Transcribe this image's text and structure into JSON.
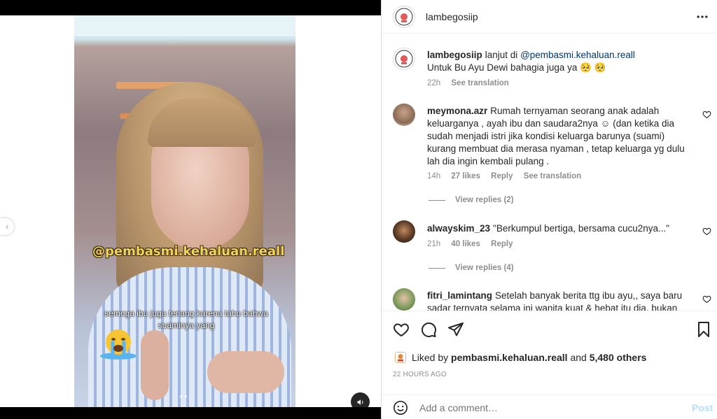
{
  "post": {
    "author": "lambegosiip",
    "caption": {
      "username": "lambegosiip",
      "text_before": "lanjut di ",
      "mention": "@pembasmi.kehaluan.reall",
      "line2": "Untuk Bu Ayu Dewi bahagia juga ya 🥺 🥺",
      "time": "22h",
      "see_translation": "See translation"
    }
  },
  "media": {
    "watermark": "@pembasmi.kehaluan.reall",
    "subtitle": "semoga ibu juga tenang karena tahu bahwa suaminya yang"
  },
  "comments": [
    {
      "username": "meymona.azr",
      "text": "Rumah ternyaman seorang anak adalah keluarganya , ayah ibu dan saudara2nya ☺ (dan ketika dia sudah menjadi istri jika kondisi keluarga barunya (suami) kurang membuat dia merasa nyaman , tetap keluarga yg dulu lah dia ingin kembali pulang .",
      "time": "14h",
      "likes": "27 likes",
      "reply": "Reply",
      "see_translation": "See translation",
      "view_replies": "View replies (2)"
    },
    {
      "username": "alwayskim_23",
      "text": "\"Berkumpul bertiga, bersama cucu2nya...\"",
      "time": "21h",
      "likes": "40 likes",
      "reply": "Reply",
      "view_replies": "View replies (4)"
    },
    {
      "username": "fitri_lamintang",
      "text": "Setelah banyak berita ttg ibu ayu,, saya baru sadar ternyata selama ini wanita kuat & hebat itu dia, bukan"
    }
  ],
  "likes_bar": {
    "prefix": "Liked by ",
    "user": "pembasmi.kehaluan.reall",
    "middle": " and ",
    "others": "5,480 others",
    "time_ago": "22 HOURS AGO"
  },
  "add_comment": {
    "placeholder": "Add a comment…",
    "post_label": "Post"
  },
  "icons": {
    "more": "more-horizontal-icon",
    "like": "heart-icon",
    "comment": "comment-icon",
    "share": "send-icon",
    "save": "bookmark-icon",
    "emoji": "emoji-icon",
    "mute": "speaker-icon",
    "prev": "chevron-left-icon"
  },
  "colors": {
    "link": "#00376b",
    "meta": "#8e8e8e",
    "post_disabled": "#b2dffc",
    "watermark": "#f1d35a"
  }
}
